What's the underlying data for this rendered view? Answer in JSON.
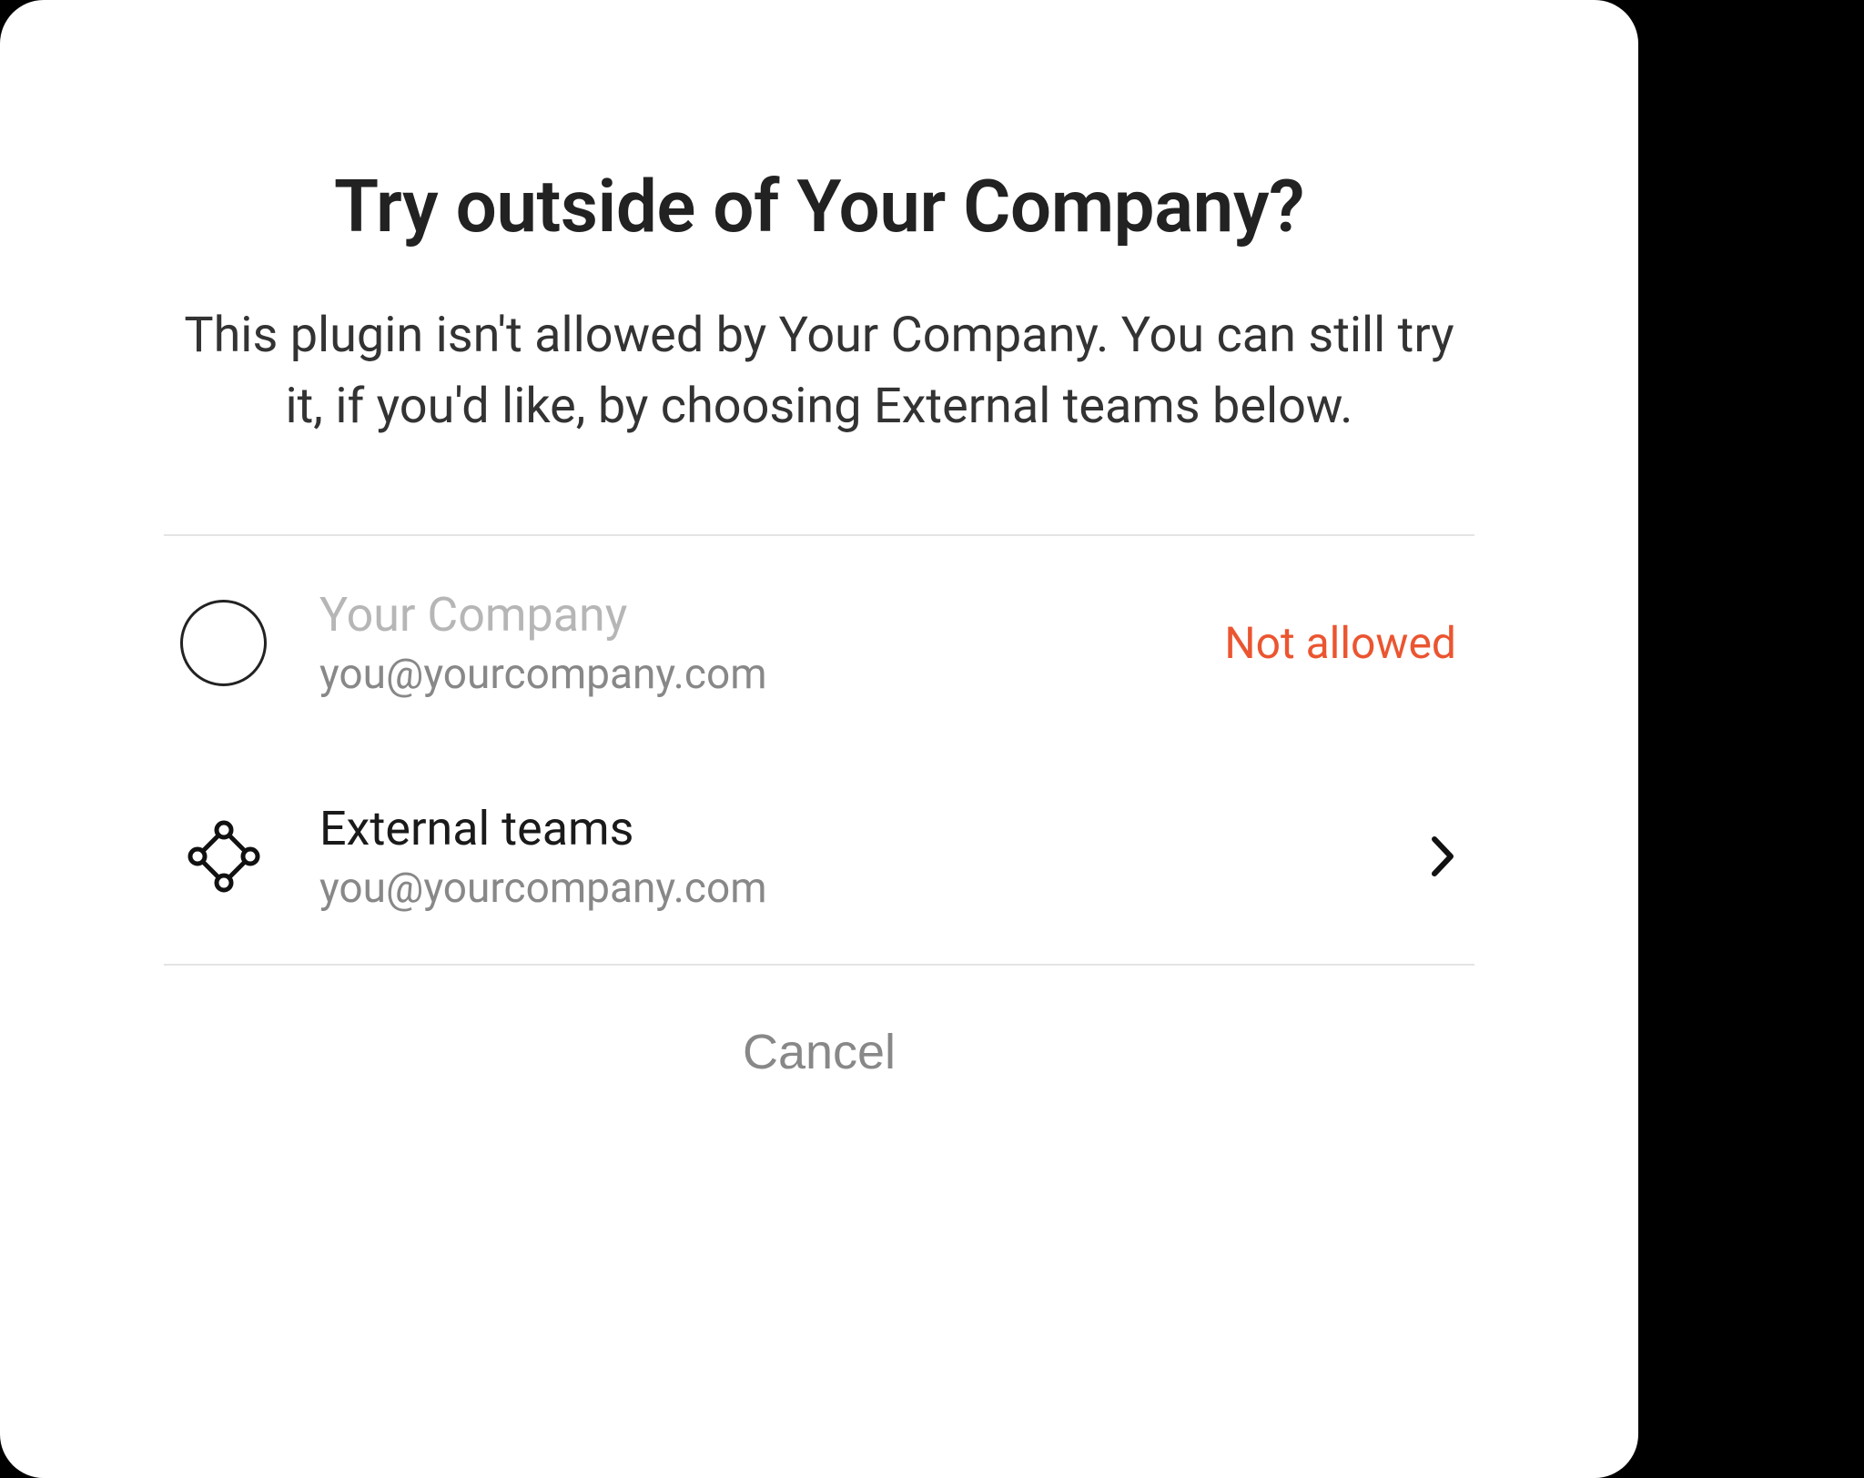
{
  "dialog": {
    "title": "Try outside of Your Company?",
    "subtitle": "This plugin isn't allowed by Your Company. You can still try it, if you'd like, by choosing External teams below."
  },
  "options": [
    {
      "title": "Your Company",
      "subtitle": "you@yourcompany.com",
      "status": "Not allowed"
    },
    {
      "title": "External teams",
      "subtitle": "you@yourcompany.com"
    }
  ],
  "actions": {
    "cancel": "Cancel"
  },
  "colors": {
    "danger": "#EB5530"
  }
}
